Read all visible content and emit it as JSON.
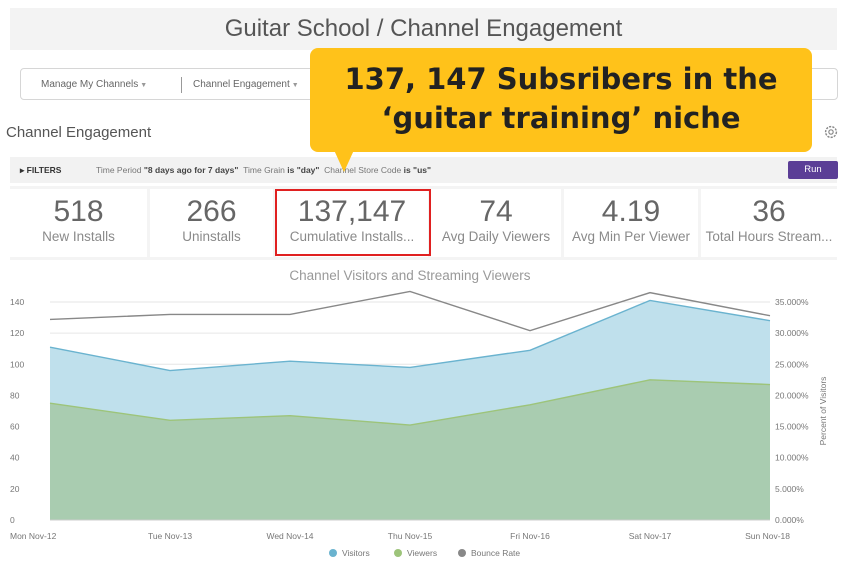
{
  "page_title": "Guitar School / Channel Engagement",
  "nav": {
    "items": [
      {
        "label": "Manage My Channels"
      },
      {
        "label": "Channel Engagement"
      }
    ]
  },
  "callout": {
    "line1": "137, 147 Subsribers in the",
    "line2": "‘guitar training’ niche",
    "color": "#ffc21a"
  },
  "section": {
    "title": "Channel Engagement",
    "settings_icon": "gear-icon"
  },
  "filters": {
    "toggle_label": "FILTERS",
    "time_period_label": "Time Period",
    "time_period_value": "\"8 days ago for 7 days\"",
    "time_grain_label": "Time Grain",
    "time_grain_value": "\"day\"",
    "store_code_label": "Channel Store Code",
    "store_code_value": "\"us\"",
    "is_word": "is",
    "run_label": "Run",
    "run_color": "#5b3e96"
  },
  "kpis": [
    {
      "value": "518",
      "label": "New Installs"
    },
    {
      "value": "266",
      "label": "Uninstalls"
    },
    {
      "value": "137,147",
      "label": "Cumulative Installs..."
    },
    {
      "value": "74",
      "label": "Avg Daily Viewers"
    },
    {
      "value": "4.19",
      "label": "Avg Min Per Viewer"
    },
    {
      "value": "36",
      "label": "Total Hours Stream..."
    }
  ],
  "highlight_color": "#e02020",
  "chart_data": {
    "type": "area",
    "title": "Channel Visitors and Streaming Viewers",
    "categories": [
      "Mon Nov-12",
      "Tue Nov-13",
      "Wed Nov-14",
      "Thu Nov-15",
      "Fri Nov-16",
      "Sat Nov-17",
      "Sun Nov-18"
    ],
    "y_left": {
      "min": 0,
      "max": 140,
      "ticks": [
        "0",
        "20",
        "40",
        "60",
        "80",
        "100",
        "120",
        "140"
      ]
    },
    "y_right": {
      "label": "Percent of Visitors",
      "min": 0,
      "max": 35,
      "ticks": [
        "0.000%",
        "5.000%",
        "10.000%",
        "15.000%",
        "20.000%",
        "25.000%",
        "30.000%",
        "35.000%"
      ]
    },
    "series": [
      {
        "name": "Visitors",
        "type": "area",
        "axis": "left",
        "values": [
          111,
          96,
          102,
          98,
          109,
          141,
          128
        ],
        "color": "#6ab3cf",
        "fill": "#bfe0ec"
      },
      {
        "name": "Viewers",
        "type": "area",
        "axis": "left",
        "values": [
          75,
          64,
          67,
          61,
          74,
          90,
          87
        ],
        "color": "#9dc47a",
        "fill": "#a9ccb0"
      },
      {
        "name": "Bounce Rate",
        "type": "line",
        "axis": "right",
        "values": [
          32.2,
          33.0,
          33.0,
          36.7,
          30.4,
          36.5,
          32.8
        ],
        "color": "#888888"
      }
    ],
    "legend_position": "bottom",
    "grid": true
  }
}
